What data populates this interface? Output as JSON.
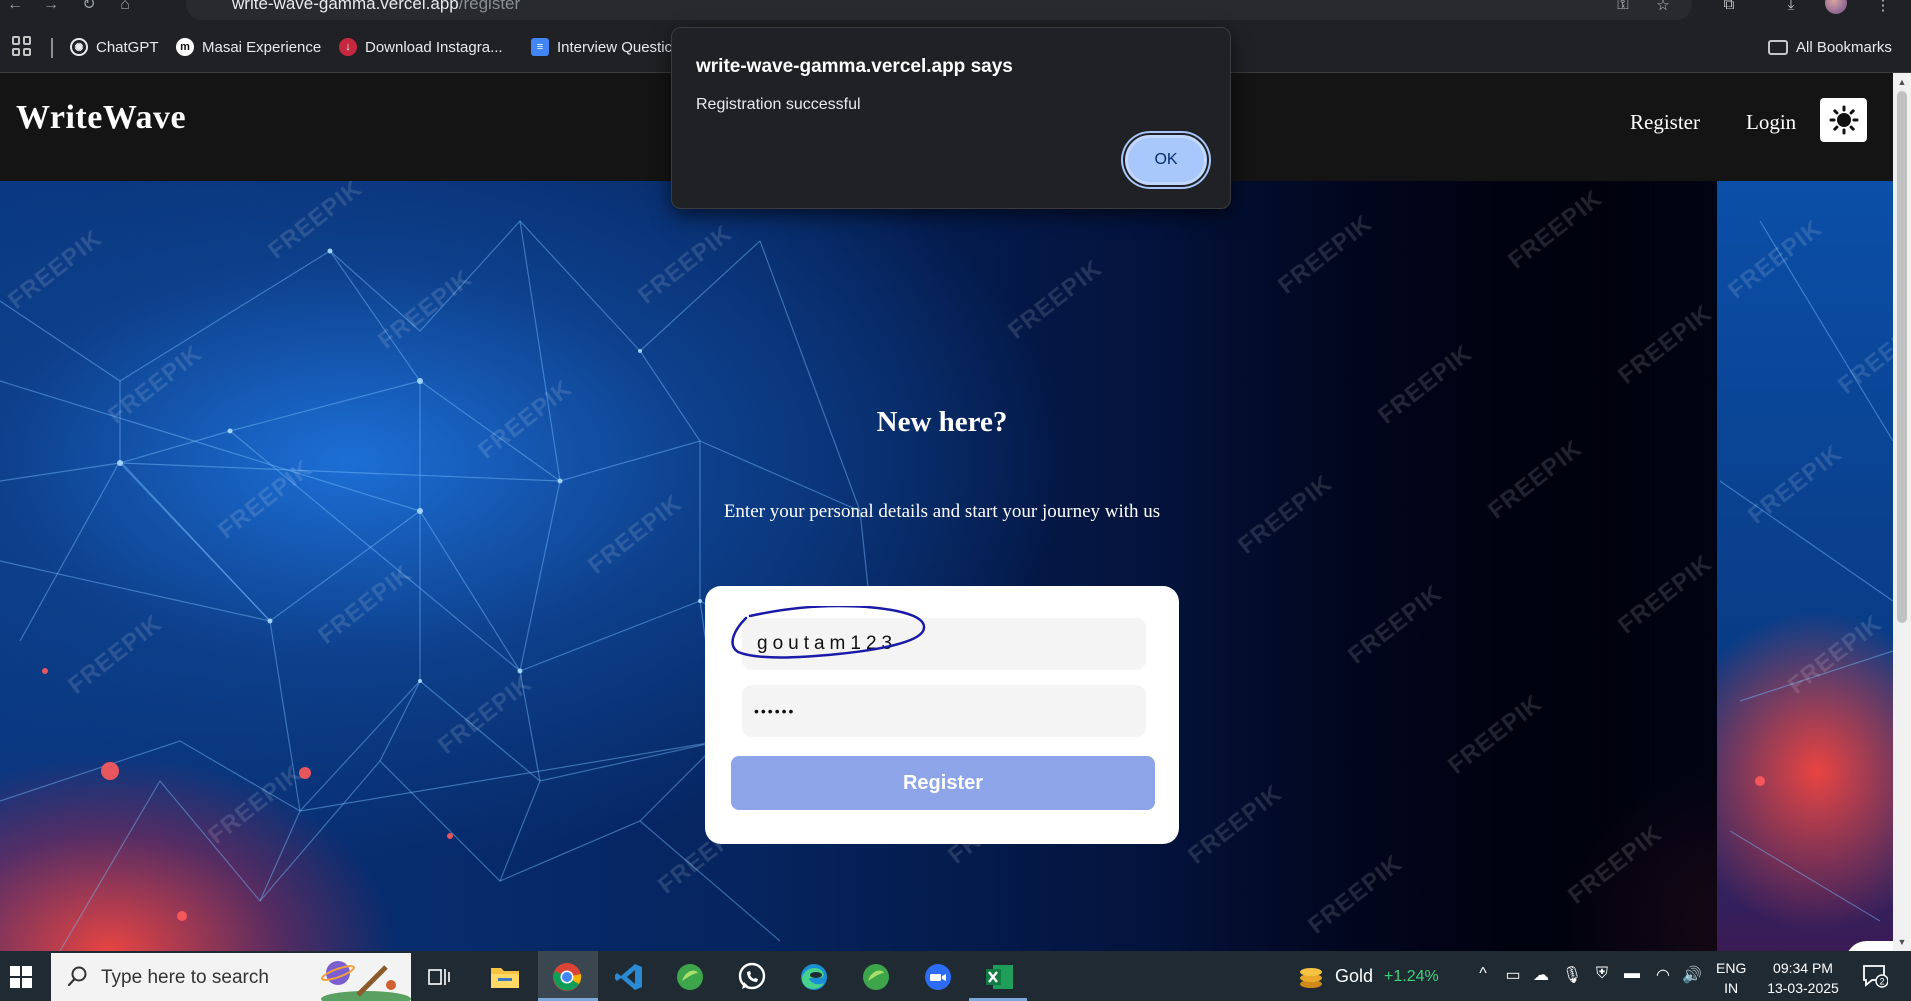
{
  "browser": {
    "url_host": "write-wave-gamma.vercel.app",
    "url_path": "/register",
    "bookmarks": [
      {
        "label": "ChatGPT"
      },
      {
        "label": "Masai Experience"
      },
      {
        "label": "Download Instagra..."
      },
      {
        "label": "Interview Questic"
      }
    ],
    "all_bookmarks_label": "All Bookmarks"
  },
  "navbar": {
    "logo": "WriteWave",
    "register_link": "Register",
    "login_link": "Login",
    "theme_toggle_icon": "sun-icon"
  },
  "hero": {
    "title": "New here?",
    "subtitle": "Enter your personal details and start your journey with us",
    "watermark": "FREEPIK"
  },
  "form": {
    "username_value": "goutam123",
    "password_value": "••••••",
    "submit_label": "Register"
  },
  "dialog": {
    "title": "write-wave-gamma.vercel.app says",
    "message": "Registration successful",
    "ok_label": "OK"
  },
  "taskbar": {
    "search_placeholder": "Type here to search",
    "widget_label": "Gold",
    "widget_change": "+1.24%",
    "language_line1": "ENG",
    "language_line2": "IN",
    "time": "09:34 PM",
    "date": "13-03-2025",
    "notification_count": "2"
  },
  "colors": {
    "navbar_bg": "#141414",
    "register_button": "#8ea4e8",
    "dialog_ok": "#a8c7fa",
    "gold_change": "#3ed37a"
  }
}
